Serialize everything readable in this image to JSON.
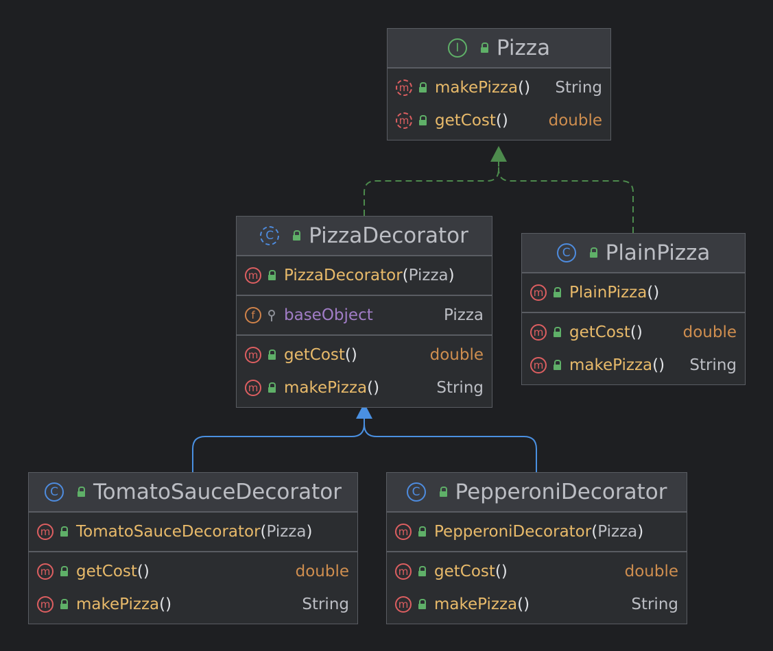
{
  "colors": {
    "background": "#1e1f22",
    "node_body": "#2b2d30",
    "node_header": "#393b40",
    "method_name": "#e8ba6a",
    "field_name": "#a17dc6",
    "type_double": "#cf8e4f",
    "implements_edge": "#4d8b4d",
    "extends_edge": "#4a90e2"
  },
  "nodes": {
    "pizza": {
      "title": "Pizza",
      "kind": "interface",
      "icon": "interface-icon",
      "methods": [
        {
          "name": "makePizza",
          "type": "String"
        },
        {
          "name": "getCost",
          "type": "double"
        }
      ]
    },
    "pizza_decorator": {
      "title": "PizzaDecorator",
      "kind": "abstract-class",
      "icon": "abstract-class-icon",
      "constructor": {
        "name": "PizzaDecorator",
        "param": "Pizza"
      },
      "field": {
        "name": "baseObject",
        "type": "Pizza"
      },
      "methods": [
        {
          "name": "getCost",
          "type": "double"
        },
        {
          "name": "makePizza",
          "type": "String"
        }
      ]
    },
    "plain_pizza": {
      "title": "PlainPizza",
      "kind": "class",
      "icon": "class-icon",
      "constructor": {
        "name": "PlainPizza"
      },
      "methods": [
        {
          "name": "getCost",
          "type": "double"
        },
        {
          "name": "makePizza",
          "type": "String"
        }
      ]
    },
    "tomato_sauce_decorator": {
      "title": "TomatoSauceDecorator",
      "kind": "class",
      "icon": "class-icon",
      "constructor": {
        "name": "TomatoSauceDecorator",
        "param": "Pizza"
      },
      "methods": [
        {
          "name": "getCost",
          "type": "double"
        },
        {
          "name": "makePizza",
          "type": "String"
        }
      ]
    },
    "pepperoni_decorator": {
      "title": "PepperoniDecorator",
      "kind": "class",
      "icon": "class-icon",
      "constructor": {
        "name": "PepperoniDecorator",
        "param": "Pizza"
      },
      "methods": [
        {
          "name": "getCost",
          "type": "double"
        },
        {
          "name": "makePizza",
          "type": "String"
        }
      ]
    }
  },
  "relations": [
    {
      "from": "PizzaDecorator",
      "to": "Pizza",
      "kind": "implements"
    },
    {
      "from": "PlainPizza",
      "to": "Pizza",
      "kind": "implements"
    },
    {
      "from": "TomatoSauceDecorator",
      "to": "PizzaDecorator",
      "kind": "extends"
    },
    {
      "from": "PepperoniDecorator",
      "to": "PizzaDecorator",
      "kind": "extends"
    }
  ]
}
